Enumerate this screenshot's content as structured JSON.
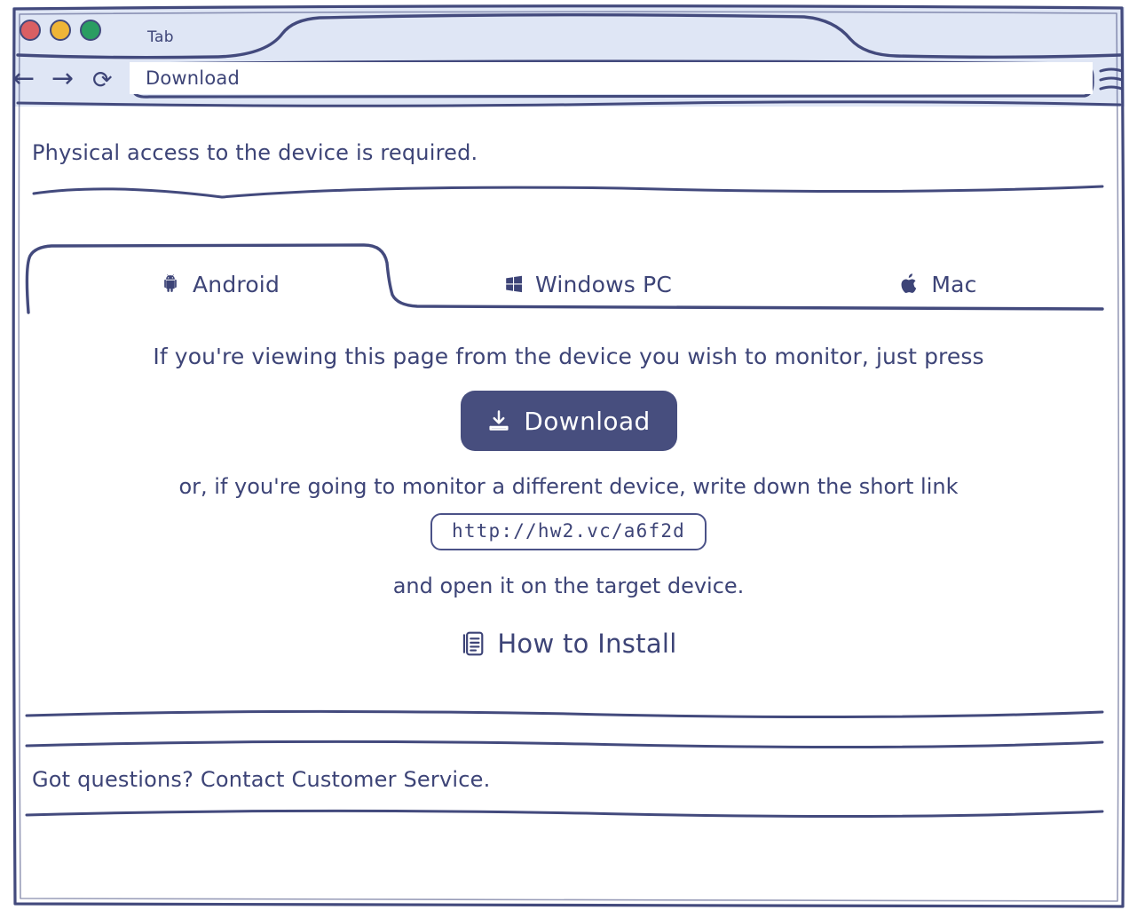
{
  "browser": {
    "tab_label": "Tab",
    "address_value": "Download",
    "nav": {
      "back": "←",
      "forward": "→",
      "reload": "⟳"
    },
    "traffic_lights": [
      {
        "name": "close",
        "color": "#d95f63"
      },
      {
        "name": "minimize",
        "color": "#efb537"
      },
      {
        "name": "maximize",
        "color": "#2a9d62"
      }
    ],
    "menu_icon": "hamburger-menu-icon"
  },
  "page": {
    "notice": "Physical access to the device is required.",
    "platform_tabs": [
      {
        "id": "android",
        "label": "Android",
        "icon": "android-icon",
        "active": true
      },
      {
        "id": "windows",
        "label": "Windows PC",
        "icon": "windows-icon",
        "active": false
      },
      {
        "id": "mac",
        "label": "Mac",
        "icon": "apple-icon",
        "active": false
      }
    ],
    "lead_text": "If you're viewing this page from the device you wish to monitor, just press",
    "download_button": {
      "label": "Download",
      "icon": "download-icon"
    },
    "alt_text": "or, if you're going to monitor a different device, write down the short link",
    "short_link": "http://hw2.vc/a6f2d",
    "open_text": "and open it on the target device.",
    "how_to_install": {
      "label": "How to Install",
      "icon": "document-list-icon"
    },
    "footer": "Got questions? Contact Customer Service."
  },
  "theme": {
    "ink": "#3d4477",
    "stroke": "#4b5288",
    "chrome_bg": "#dfe6f5",
    "accent": "#474e7e",
    "page_bg": "#ffffff"
  }
}
